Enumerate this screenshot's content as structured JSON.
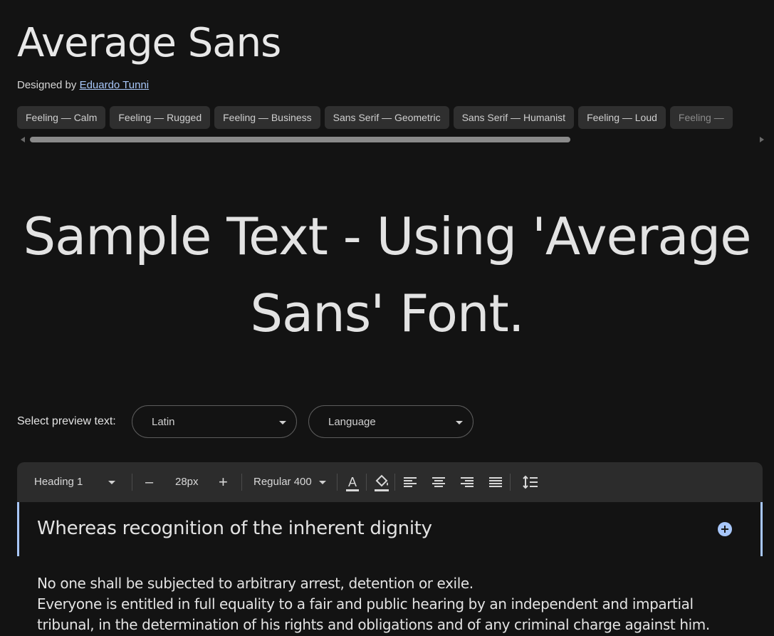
{
  "font": {
    "name": "Average Sans",
    "designed_by_label": "Designed by",
    "designer": "Eduardo Tunni"
  },
  "tags": [
    "Feeling — Calm",
    "Feeling — Rugged",
    "Feeling — Business",
    "Sans Serif — Geometric",
    "Sans Serif — Humanist",
    "Feeling — Loud",
    "Feeling —"
  ],
  "sample": {
    "line1": "Sample Text - Using 'Average",
    "line2": "Sans' Font."
  },
  "preview": {
    "label": "Select preview text:",
    "script_select": "Latin",
    "language_select": "Language"
  },
  "toolbar": {
    "style": "Heading 1",
    "decrease": "–",
    "size": "28px",
    "increase": "+",
    "weight": "Regular 400",
    "text_color_icon": "text-color-icon",
    "highlight_icon": "fill-color-icon",
    "align_left_icon": "align-left-icon",
    "align_center_icon": "align-center-icon",
    "align_right_icon": "align-right-icon",
    "align_justify_icon": "align-justify-icon",
    "line_height_icon": "line-height-icon",
    "accent": "#a8c7fa"
  },
  "editor": {
    "heading": "Whereas recognition of the inherent dignity",
    "body_lines": [
      "No one shall be subjected to arbitrary arrest, detention or exile.",
      "Everyone is entitled in full equality to a fair and public hearing by an independent and impartial",
      "tribunal, in the determination of his rights and obligations and of any criminal charge against him."
    ]
  }
}
